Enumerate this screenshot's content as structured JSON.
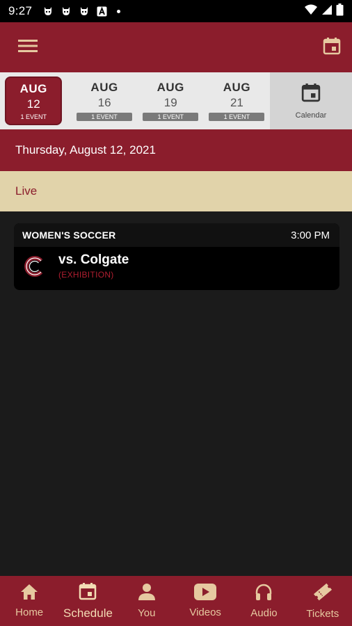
{
  "status_bar": {
    "time": "9:27"
  },
  "colors": {
    "primary": "#8b1d2c",
    "accent": "#e1d3aa",
    "background": "#1b1b1b",
    "exhibition": "#b01e30"
  },
  "date_strip": {
    "tiles": [
      {
        "month": "AUG",
        "day": "12",
        "events": "1 EVENT",
        "selected": true
      },
      {
        "month": "AUG",
        "day": "16",
        "events": "1 EVENT",
        "selected": false
      },
      {
        "month": "AUG",
        "day": "19",
        "events": "1 EVENT",
        "selected": false
      },
      {
        "month": "AUG",
        "day": "21",
        "events": "1 EVENT",
        "selected": false
      }
    ],
    "calendar_label": "Calendar"
  },
  "date_header": "Thursday, August 12, 2021",
  "live_label": "Live",
  "event": {
    "sport": "WOMEN'S SOCCER",
    "time": "3:00 PM",
    "opponent": "vs. Colgate",
    "note": "(EXHIBITION)"
  },
  "bottom_nav": [
    {
      "label": "Home",
      "icon": "home-icon",
      "active": false
    },
    {
      "label": "Schedule",
      "icon": "calendar-icon",
      "active": true
    },
    {
      "label": "You",
      "icon": "person-icon",
      "active": false
    },
    {
      "label": "Videos",
      "icon": "play-icon",
      "active": false
    },
    {
      "label": "Audio",
      "icon": "headphones-icon",
      "active": false
    },
    {
      "label": "Tickets",
      "icon": "ticket-icon",
      "active": false
    }
  ]
}
